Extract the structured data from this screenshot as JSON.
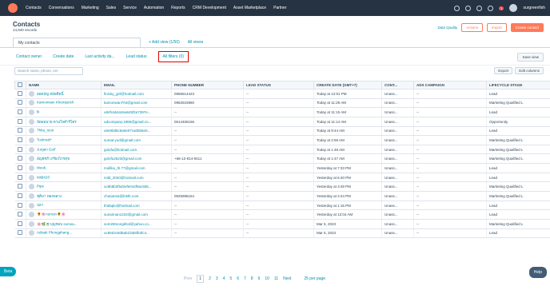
{
  "nav": {
    "items": [
      "Contacts",
      "Conversations",
      "Marketing",
      "Sales",
      "Service",
      "Automation",
      "Reports",
      "CRM Development",
      "Asset Marketplace",
      "Partner"
    ],
    "notif_count": "1",
    "account": "surgreenfish"
  },
  "header": {
    "title": "Contacts",
    "records": "14,940 records",
    "data_quality": "Data Quality",
    "actions": "Actions",
    "import": "Import",
    "create": "Create contact"
  },
  "tabs": {
    "current": "My contacts",
    "add_view": "+ Add view (1/50)",
    "all_views": "All views"
  },
  "filters": {
    "owner": "Contact owner",
    "date": "Create date",
    "activity": "Last activity da...",
    "lead": "Lead status",
    "all": "All filters (0)",
    "save": "Save view"
  },
  "toolbar": {
    "search_placeholder": "Search name, phone, em",
    "export": "Export",
    "edit_columns": "Edit columns"
  },
  "columns": [
    "Name",
    "Email",
    "Phone Number",
    "Lead Status",
    "Create Date (GMT+7)",
    "Cont...",
    "Ads Campaign",
    "Lifecycle Stage"
  ],
  "rows": [
    [
      "ยอดบัญ สมัยติดนิ์",
      "finicky_girl@hotmail.com",
      "0955514423",
      "--",
      "Today at 12:51 PM",
      "Unass...",
      "--",
      "Lead"
    ],
    [
      "Kamonwan Khempetch",
      "kamonwan704@gmail.com",
      "0962515950",
      "--",
      "Today at 11:28 AM",
      "Unass...",
      "--",
      "Marketing Qualified L"
    ],
    [
      "lk",
      "u84fca54a3ea645f2e7397e...",
      "--",
      "--",
      "Today at 11:15 AM",
      "Unass...",
      "--",
      "Lead"
    ],
    [
      "ปัดลอนาย ตามใจคำรีโตร",
      "udcompany.1986@gmail.co...",
      "0614455156",
      "--",
      "Today at 11:14 AM",
      "Unass...",
      "--",
      "Opportunity"
    ],
    [
      "Thita_toon",
      "u0e90d5c5a0e07ca0bb5e0...",
      "--",
      "--",
      "Today at 9:44 AM",
      "Unass...",
      "--",
      "Lead"
    ],
    [
      "Toolmub*",
      "sumat.yod@gmail.com",
      "--",
      "--",
      "Today at 2:59 AM",
      "Unass...",
      "--",
      "Marketing Qualified L"
    ],
    [
      "Jurgen Goif",
      "golofu@hotmail.com",
      "--",
      "--",
      "Today at 1:48 AM",
      "Unass...",
      "--",
      "Marketing Qualified L"
    ],
    [
      "อัญพัชร์ เกรียงไกรสุข",
      "golofu2523@gmail.com",
      "+66-12-814-9411",
      "--",
      "Today at 1:47 AM",
      "Unass...",
      "--",
      "Marketing Qualified L"
    ],
    [
      "Mook..",
      "mollika_th.77@gmail.com",
      "--",
      "--",
      "Yesterday at 7:33 PM",
      "Unass...",
      "--",
      "Lead"
    ],
    [
      "Mild42©",
      "mild_2020@hotmail.com",
      "--",
      "--",
      "Yesterday at 6:40 PM",
      "Unass...",
      "--",
      "Lead"
    ],
    [
      "Pipe",
      "uc8b8b2f5d2efe044f9ac555...",
      "--",
      "--",
      "Yesterday at 3:49 PM",
      "Unass...",
      "--",
      "Marketing Qualified L"
    ],
    [
      "ชุติมา ทองพลาง",
      "chutiarnia@lnkth.com",
      "0925996154",
      "--",
      "Yesterday at 3:44 PM",
      "Unass...",
      "--",
      "Marketing Qualified L"
    ],
    [
      "ปลา",
      "thidaplo@hotmail.com",
      "--",
      "--",
      "Yesterday at 1:15 PM",
      "Unass...",
      "--",
      "Lead"
    ],
    [
      "🌻🌸numun🌻🌸",
      "sunarinan1234@gmail.com",
      "--",
      "--",
      "Yesterday at 12:04 AM",
      "Unass...",
      "--",
      "Lead"
    ],
    [
      "🌸🌿☕บุญชอบ somsa...",
      "som29mongkhol@yahoo.co...",
      "--",
      "--",
      "Mar 5, 2023",
      "Unass...",
      "--",
      "Marketing Qualified L"
    ],
    [
      "Adisak Phongphang...",
      "uc85d4c8d8ab1fab6fb3fc4...",
      "--",
      "--",
      "Mar 5, 2023",
      "Unass...",
      "--",
      "Lead"
    ]
  ],
  "pagination": {
    "prev": "Prev",
    "pages": [
      "1",
      "2",
      "3",
      "4",
      "5",
      "6",
      "7",
      "8",
      "9",
      "10",
      "11"
    ],
    "next": "Next",
    "per_page": "25 per page"
  },
  "beta": "Beta",
  "help": "Help"
}
